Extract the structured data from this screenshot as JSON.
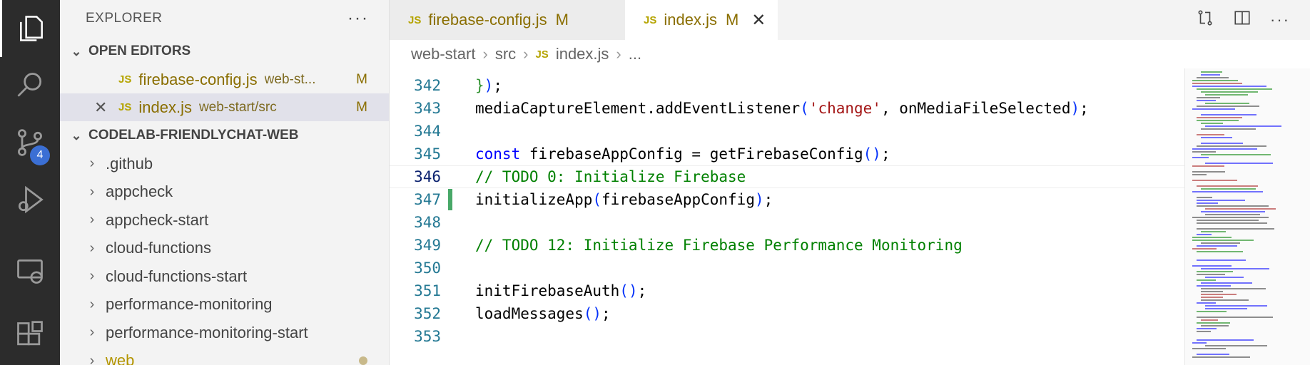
{
  "activity_bar": {
    "items": [
      {
        "name": "explorer-icon",
        "active": true
      },
      {
        "name": "search-icon"
      },
      {
        "name": "source-control-icon",
        "badge": "4"
      },
      {
        "name": "run-debug-icon"
      },
      {
        "name": "remote-explorer-icon"
      },
      {
        "name": "extensions-icon"
      }
    ]
  },
  "sidebar": {
    "title": "EXPLORER",
    "more": "···",
    "open_editors": {
      "label": "OPEN EDITORS",
      "files": [
        {
          "icon": "JS",
          "name": "firebase-config.js",
          "hint": "web-st...",
          "status": "M"
        },
        {
          "icon": "JS",
          "name": "index.js",
          "hint": "web-start/src",
          "status": "M",
          "close": "✕"
        }
      ]
    },
    "workspace": {
      "label": "CODELAB-FRIENDLYCHAT-WEB",
      "folders": [
        ".github",
        "appcheck",
        "appcheck-start",
        "cloud-functions",
        "cloud-functions-start",
        "performance-monitoring",
        "performance-monitoring-start",
        "web"
      ]
    }
  },
  "tabs": [
    {
      "icon": "JS",
      "label": "firebase-config.js",
      "status": "M"
    },
    {
      "icon": "JS",
      "label": "index.js",
      "status": "M",
      "close": "✕"
    }
  ],
  "breadcrumb": {
    "parts": [
      "web-start",
      "src",
      "index.js",
      "..."
    ],
    "file_icon": "JS"
  },
  "editor": {
    "current_line": "346",
    "lines": [
      {
        "num": "342",
        "text": "});"
      },
      {
        "num": "343",
        "text": "mediaCaptureElement.addEventListener('change', onMediaFileSelected);"
      },
      {
        "num": "344",
        "text": ""
      },
      {
        "num": "345",
        "text": "const firebaseAppConfig = getFirebaseConfig();"
      },
      {
        "num": "346",
        "text": "// TODO 0: Initialize Firebase"
      },
      {
        "num": "347",
        "text": "initializeApp(firebaseAppConfig);"
      },
      {
        "num": "348",
        "text": ""
      },
      {
        "num": "349",
        "text": "// TODO 12: Initialize Firebase Performance Monitoring"
      },
      {
        "num": "350",
        "text": ""
      },
      {
        "num": "351",
        "text": "initFirebaseAuth();"
      },
      {
        "num": "352",
        "text": "loadMessages();"
      },
      {
        "num": "353",
        "text": ""
      }
    ]
  },
  "colors": {
    "keyword": "#0000ff",
    "string": "#a31515",
    "comment": "#008000",
    "modified": "#8a6e00",
    "activity_bg": "#2c2c2c",
    "badge": "#3b6fd4"
  }
}
